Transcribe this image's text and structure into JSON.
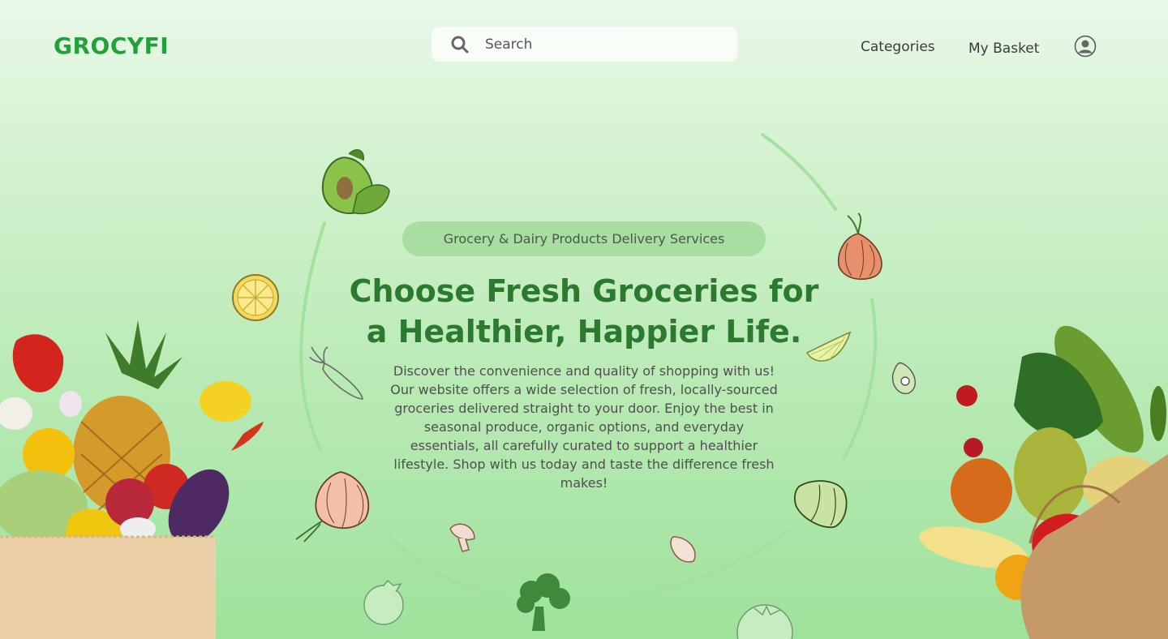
{
  "header": {
    "logo": "GROCYFI",
    "search": {
      "placeholder": "Search",
      "icon": "search-icon"
    },
    "nav": {
      "categories": "Categories",
      "basket": "My Basket"
    },
    "profile_icon": "user-profile-icon"
  },
  "hero": {
    "badge": "Grocery & Dairy Products Delivery Services",
    "headline_lines": [
      "Choose Fresh Groceries for",
      "a Healthier, Happier Life."
    ],
    "description_lines": [
      "Discover the convenience and quality of shopping with us!",
      "Our website offers a wide selection of fresh, locally-sourced",
      "groceries delivered straight to your door. Enjoy the best in",
      "seasonal produce, organic options, and everyday",
      "essentials, all carefully curated to support a healthier",
      "lifestyle. Shop with us today and taste the difference fresh",
      "makes!"
    ]
  },
  "colors": {
    "brand_green": "#22a13a",
    "headline_green": "#2b7a2f",
    "badge_bg": "#a8dea1",
    "ring": "#9fe29c"
  },
  "decor_icons": [
    "avocado-icon",
    "onion-icon",
    "lemon-slice-icon",
    "carrot-icon",
    "lime-wedge-icon",
    "avocado-half-icon",
    "onion-sketch-icon",
    "bell-pepper-icon",
    "mushroom-icon",
    "mushroom-slice-icon",
    "broccoli-icon",
    "tomato-icon",
    "tomato-outline-icon",
    "grocery-bag-left-image",
    "grocery-bag-right-image"
  ]
}
